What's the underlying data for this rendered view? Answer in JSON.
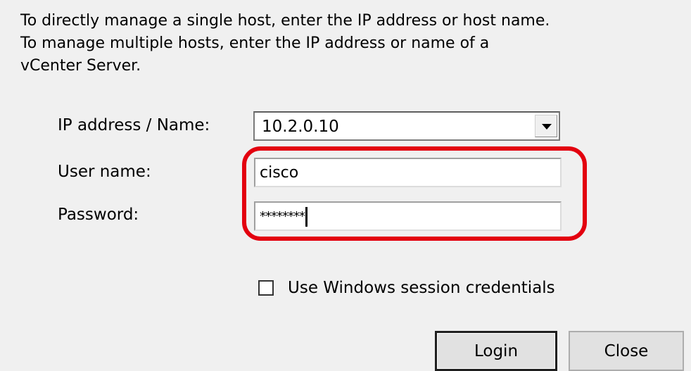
{
  "intro": {
    "line1": "To directly manage a single host, enter the IP address or host name.",
    "line2": "To manage multiple hosts, enter the IP address or name of a",
    "line3": "vCenter Server."
  },
  "form": {
    "ip_label": "IP address / Name:",
    "ip_value": "10.2.0.10",
    "ip_dropdown_icon": "chevron-down-icon",
    "user_label": "User name:",
    "user_value": "cisco",
    "password_label": "Password:",
    "password_value": "********",
    "use_windows_credentials_label": "Use Windows session credentials",
    "use_windows_credentials_checked": false
  },
  "buttons": {
    "login": "Login",
    "close": "Close"
  },
  "annotation": {
    "highlight_color": "#e3000f"
  }
}
